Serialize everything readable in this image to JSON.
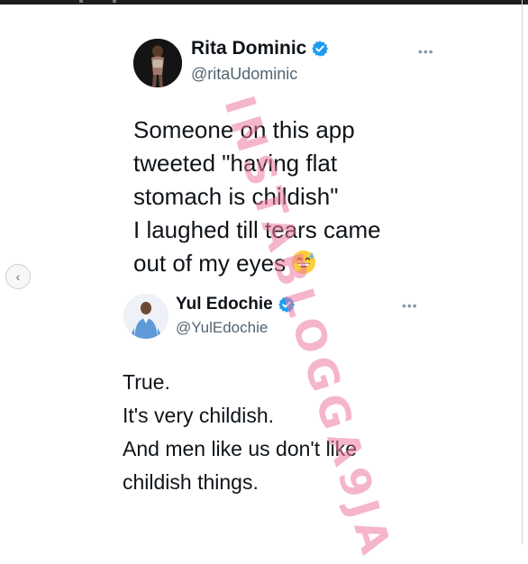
{
  "post": {
    "original_tweet": {
      "display_name": "Rita Dominic",
      "handle": "@ritaUdominic",
      "more_icon": "more-dots-icon",
      "verified_icon": "verified-badge-icon",
      "text_lines": [
        "Someone on this app",
        "tweeted \"having flat",
        "stomach is childish\"",
        "I laughed till tears came",
        "out of my eyes"
      ],
      "emoji": "grinning-sweat-emoji"
    },
    "reply_tweet": {
      "display_name": "Yul Edochie",
      "handle": "@YulEdochie",
      "more_icon": "more-dots-icon",
      "verified_icon": "verified-badge-icon",
      "text_lines": [
        "True.",
        "It's very childish.",
        "And men like us don't like",
        "childish things."
      ]
    },
    "watermark": "INSTABLOGGA9JA",
    "nav": {
      "prev_icon": "chevron-left-icon"
    }
  },
  "colors": {
    "verified_blue": "#1d9bf0",
    "text_primary": "#0f1419",
    "text_secondary": "#536471",
    "watermark_pink": "#ec78a0"
  }
}
